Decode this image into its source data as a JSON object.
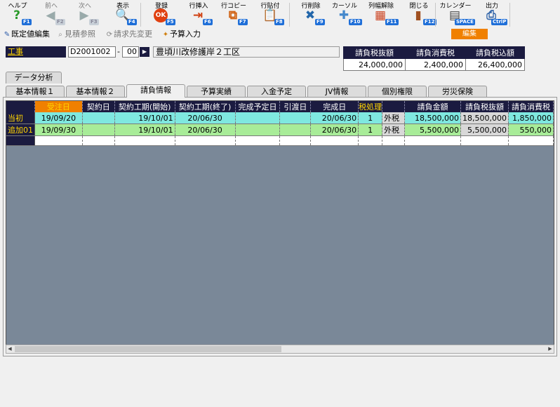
{
  "toolbar": [
    {
      "label": "ヘルプ",
      "icon": "help-icon",
      "glyph": "?",
      "color": "#2a9a2a",
      "fkey": "F1",
      "disabled": false
    },
    {
      "label": "前へ",
      "icon": "arrow-left-icon",
      "glyph": "◀",
      "color": "#9aa",
      "fkey": "F2",
      "disabled": true
    },
    {
      "label": "次へ",
      "icon": "arrow-right-icon",
      "glyph": "▶",
      "color": "#9aa",
      "fkey": "F3",
      "disabled": true
    },
    {
      "label": "表示",
      "icon": "magnifier-icon",
      "glyph": "🔍",
      "color": "#2266aa",
      "fkey": "F4",
      "disabled": false
    },
    {
      "label": "登録",
      "icon": "ok-icon",
      "glyph": "OK",
      "color": "#e04010",
      "fkey": "F5",
      "disabled": false
    },
    {
      "label": "行挿入",
      "icon": "row-insert-icon",
      "glyph": "⇥",
      "color": "#d04010",
      "fkey": "F6",
      "disabled": false
    },
    {
      "label": "行コピー",
      "icon": "row-copy-icon",
      "glyph": "⧉",
      "color": "#d06010",
      "fkey": "F7",
      "disabled": false
    },
    {
      "label": "行貼付",
      "icon": "row-paste-icon",
      "glyph": "📋",
      "color": "#c04010",
      "fkey": "F8",
      "disabled": false
    },
    {
      "label": "行削除",
      "icon": "row-delete-icon",
      "glyph": "✖",
      "color": "#2266aa",
      "fkey": "F9",
      "disabled": false
    },
    {
      "label": "カーソル",
      "icon": "cursor-icon",
      "glyph": "✚",
      "color": "#4488cc",
      "fkey": "F10",
      "disabled": false
    },
    {
      "label": "列幅解除",
      "icon": "column-width-icon",
      "glyph": "▦",
      "color": "#cc4422",
      "fkey": "F11",
      "disabled": false
    },
    {
      "label": "閉じる",
      "icon": "close-door-icon",
      "glyph": "▮",
      "color": "#a05020",
      "fkey": "F12",
      "disabled": false
    },
    {
      "label": "カレンダー",
      "icon": "calendar-icon",
      "glyph": "▤",
      "color": "#444",
      "fkey": "SPACE",
      "disabled": false
    },
    {
      "label": "出力",
      "icon": "printer-icon",
      "glyph": "⎙",
      "color": "#3366aa",
      "fkey": "CtrlP",
      "disabled": false
    }
  ],
  "row2": {
    "default_edit": "既定値編集",
    "estimate_ref": "見積参照",
    "billing_change": "請求先変更",
    "budget_input": "予算入力",
    "edit_button": "編集"
  },
  "header": {
    "kouji_label": "工事",
    "project_code": "D2001002",
    "dash": "-",
    "branch": "00",
    "nav": "▶",
    "project_name": "豊頃川改修護岸２工区"
  },
  "summary": {
    "headers": [
      "請負税抜額",
      "請負消費税",
      "請負税込額"
    ],
    "values": [
      "24,000,000",
      "2,400,000",
      "26,400,000"
    ]
  },
  "subtab": "データ分析",
  "tabs": [
    "基本情報１",
    "基本情報２",
    "請負情報",
    "予算実績",
    "入金予定",
    "JV情報",
    "個別権限",
    "労災保険"
  ],
  "active_tab": 2,
  "grid": {
    "columns": [
      "受注日",
      "契約日",
      "契約工期(開始)",
      "契約工期(終了)",
      "完成予定日",
      "引渡日",
      "完成日",
      "税処理",
      "",
      "請負金額",
      "請負税抜額",
      "請負消費税"
    ],
    "rows": [
      {
        "label": "当初",
        "cells": [
          "19/09/20",
          "",
          "19/10/01",
          "20/06/30",
          "",
          "",
          "20/06/30",
          "1",
          "外税",
          "18,500,000",
          "18,500,000",
          "1,850,000"
        ]
      },
      {
        "label": "追加01",
        "cells": [
          "19/09/30",
          "",
          "19/10/01",
          "20/06/30",
          "",
          "",
          "20/06/30",
          "1",
          "外税",
          "5,500,000",
          "5,500,000",
          "550,000"
        ]
      }
    ]
  }
}
